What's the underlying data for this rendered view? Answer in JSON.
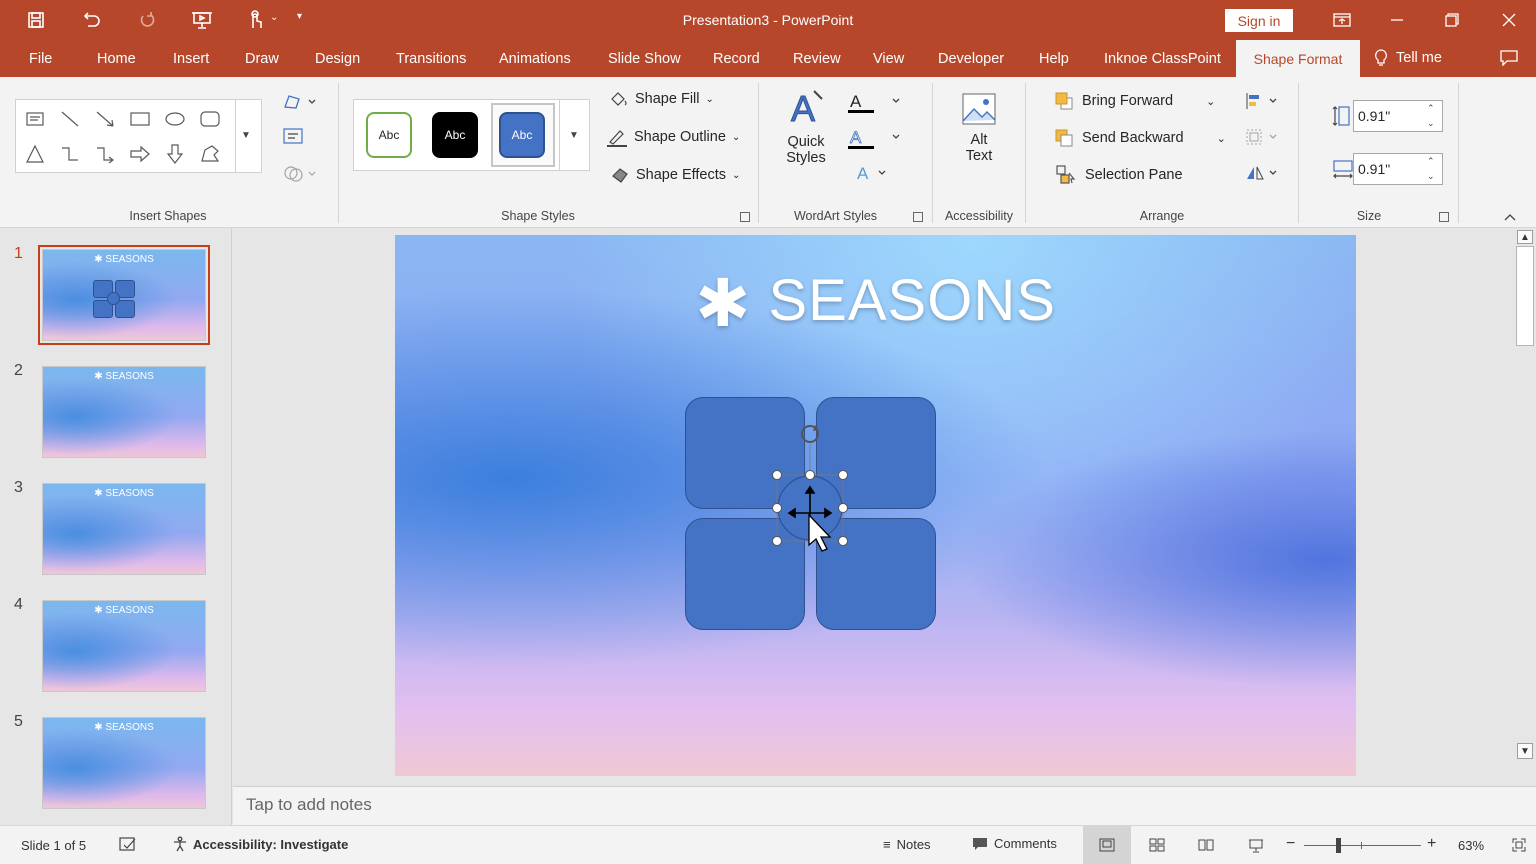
{
  "app": {
    "title": "Presentation3  -  PowerPoint",
    "sign_in": "Sign in"
  },
  "tabs": [
    "File",
    "Home",
    "Insert",
    "Draw",
    "Design",
    "Transitions",
    "Animations",
    "Slide Show",
    "Record",
    "Review",
    "View",
    "Developer",
    "Help",
    "Inknoe ClassPoint",
    "Shape Format"
  ],
  "active_tab": "Shape Format",
  "tell_me": "Tell me",
  "ribbon": {
    "insert_shapes": {
      "label": "Insert Shapes"
    },
    "shape_styles": {
      "label": "Shape Styles",
      "presets": [
        "Abc",
        "Abc",
        "Abc"
      ],
      "shape_fill": "Shape Fill",
      "shape_outline": "Shape Outline",
      "shape_effects": "Shape Effects"
    },
    "wordart": {
      "label": "WordArt Styles",
      "quick_styles": "Quick",
      "quick_styles_2": "Styles"
    },
    "accessibility": {
      "label": "Accessibility",
      "alt_text": "Alt",
      "alt_text_2": "Text"
    },
    "arrange": {
      "label": "Arrange",
      "bring_forward": "Bring Forward",
      "send_backward": "Send Backward",
      "selection_pane": "Selection Pane"
    },
    "size": {
      "label": "Size",
      "height": "0.91\"",
      "width": "0.91\""
    }
  },
  "thumbnails": [
    {
      "num": "1",
      "title": "SEASONS"
    },
    {
      "num": "2",
      "title": "SEASONS"
    },
    {
      "num": "3",
      "title": "SEASONS"
    },
    {
      "num": "4",
      "title": "SEASONS"
    },
    {
      "num": "5",
      "title": "SEASONS"
    }
  ],
  "slide": {
    "title": "SEASONS",
    "title_icon": "asterisk-icon"
  },
  "notes_placeholder": "Tap to add notes",
  "status": {
    "slide_info": "Slide 1 of 5",
    "accessibility": "Accessibility: Investigate",
    "notes": "Notes",
    "comments": "Comments",
    "zoom": "63%"
  },
  "colors": {
    "accent": "#b7472a",
    "shape_fill": "#4472c4"
  }
}
